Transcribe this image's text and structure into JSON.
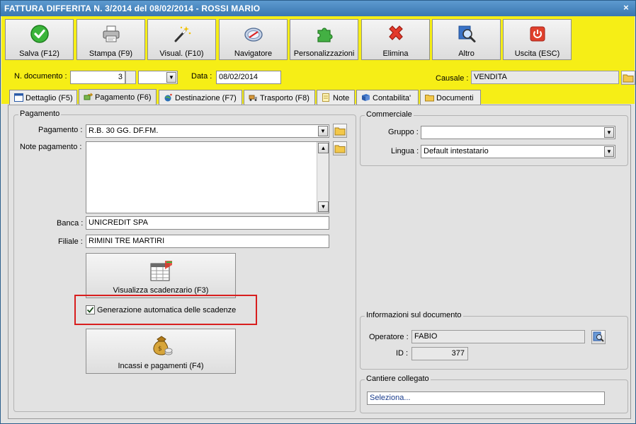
{
  "window": {
    "title": "FATTURA DIFFERITA N. 3/2014 del 08/02/2014 - ROSSI MARIO",
    "close_glyph": "×"
  },
  "toolbar": {
    "buttons": [
      {
        "label": "Salva (F12)",
        "icon": "check-icon"
      },
      {
        "label": "Stampa (F9)",
        "icon": "printer-icon"
      },
      {
        "label": "Visual. (F10)",
        "icon": "magic-wand-icon"
      },
      {
        "label": "Navigatore",
        "icon": "compass-icon"
      },
      {
        "label": "Personalizzazioni",
        "icon": "puzzle-icon"
      },
      {
        "label": "Elimina",
        "icon": "delete-x-icon"
      },
      {
        "label": "Altro",
        "icon": "magnifier-icon"
      },
      {
        "label": "Uscita (ESC)",
        "icon": "power-icon"
      }
    ]
  },
  "header": {
    "doc_number_label": "N. documento :",
    "doc_number_value": "3",
    "date_label": "Data :",
    "date_value": "08/02/2014",
    "causale_label": "Causale :",
    "causale_value": "VENDITA"
  },
  "tabs": [
    {
      "label": "Dettaglio (F5)",
      "icon": "grid-icon"
    },
    {
      "label": "Pagamento (F6)",
      "icon": "money-arrow-icon"
    },
    {
      "label": "Destinazione (F7)",
      "icon": "globe-icon"
    },
    {
      "label": "Trasporto (F8)",
      "icon": "truck-icon"
    },
    {
      "label": "Note",
      "icon": "note-icon"
    },
    {
      "label": "Contabilita'",
      "icon": "book-icon"
    },
    {
      "label": "Documenti",
      "icon": "folder-icon"
    }
  ],
  "pagamento": {
    "group_title": "Pagamento",
    "pagamento_label": "Pagamento :",
    "pagamento_value": "R.B. 30 GG. DF.FM.",
    "note_label": "Note pagamento :",
    "note_value": "",
    "banca_label": "Banca :",
    "banca_value": "UNICREDIT SPA",
    "filiale_label": "Filiale :",
    "filiale_value": "RIMINI TRE MARTIRI",
    "scadenzario_button": "Visualizza scadenzario (F3)",
    "auto_scadenze_label": "Generazione automatica delle scadenze",
    "auto_scadenze_checked": true,
    "incassi_button": "Incassi e pagamenti (F4)"
  },
  "commerciale": {
    "group_title": "Commerciale",
    "gruppo_label": "Gruppo :",
    "gruppo_value": "",
    "lingua_label": "Lingua :",
    "lingua_value": "Default intestatario"
  },
  "info": {
    "group_title": "Informazioni sul documento",
    "operatore_label": "Operatore :",
    "operatore_value": "FABIO",
    "id_label": "ID :",
    "id_value": "377"
  },
  "cantiere": {
    "group_title": "Cantiere collegato",
    "placeholder": "Seleziona..."
  },
  "colors": {
    "toolbar_bg": "#f6ee16",
    "titlebar": "#3a77b0",
    "highlight": "#d81e1e"
  }
}
